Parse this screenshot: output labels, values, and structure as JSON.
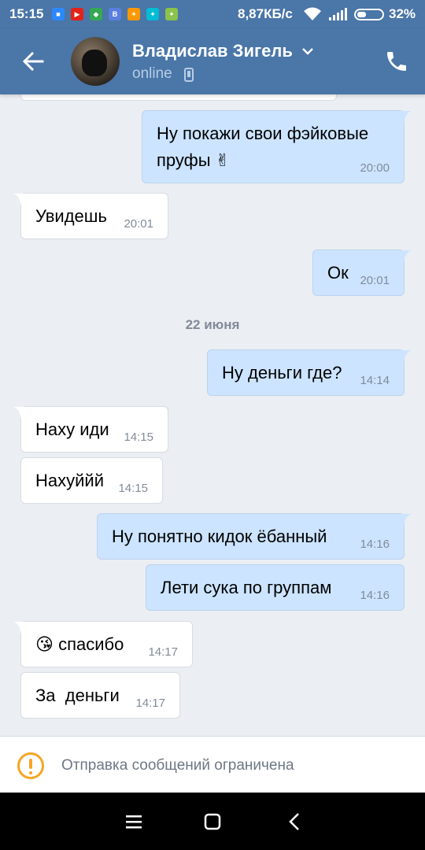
{
  "status_bar": {
    "time": "15:15",
    "speed": "8,87КБ/с",
    "battery": "32%",
    "app_icons": [
      {
        "name": "app-icon",
        "color": "#2d88ff",
        "glyph": "■"
      },
      {
        "name": "youtube-icon",
        "color": "#e62117",
        "glyph": "▶"
      },
      {
        "name": "maps-icon",
        "color": "#34a853",
        "glyph": "◆"
      },
      {
        "name": "vk-icon",
        "color": "#5b7fde",
        "glyph": "В"
      },
      {
        "name": "pinwheel-icon",
        "color": "#ff9800",
        "glyph": "✦"
      },
      {
        "name": "pinwheel-icon",
        "color": "#00bcd4",
        "glyph": "✦"
      },
      {
        "name": "pinwheel-icon",
        "color": "#8bc34a",
        "glyph": "✦"
      }
    ]
  },
  "header": {
    "name": "Владислав Зигель",
    "status": "online"
  },
  "messages": [
    {
      "direction": "out",
      "text": "Ну покажи свои фэйковые пруфы ✌",
      "line1": "Ну покажи свои фэйковые",
      "line2": "пруфы ✌",
      "time": "20:00"
    },
    {
      "direction": "in",
      "text": "Увидешь",
      "time": "20:01"
    },
    {
      "direction": "out",
      "text": "Ок",
      "time": "20:01"
    },
    {
      "direction": "out",
      "text": "Ну деньги где?",
      "time": "14:14"
    },
    {
      "direction": "in",
      "text": "Наху иди",
      "time": "14:15"
    },
    {
      "direction": "in",
      "text": "Нахуййй",
      "time": "14:15"
    },
    {
      "direction": "out",
      "text": "Ну понятно кидок ёбанный",
      "time": "14:16"
    },
    {
      "direction": "out",
      "text": "Лети сука по группам",
      "time": "14:16"
    },
    {
      "direction": "in",
      "text": "😘 спасибо",
      "emoji": "😘",
      "label": "спасибо",
      "time": "14:17"
    },
    {
      "direction": "in",
      "text": "За  деньги",
      "time": "14:17"
    }
  ],
  "date_separator": "22 июня",
  "footer": {
    "notice": "Отправка сообщений ограничена"
  },
  "colors": {
    "accent": "#4a76a8",
    "out_bubble": "#cce4ff",
    "in_bubble": "#ffffff",
    "warning": "#f5a623"
  }
}
